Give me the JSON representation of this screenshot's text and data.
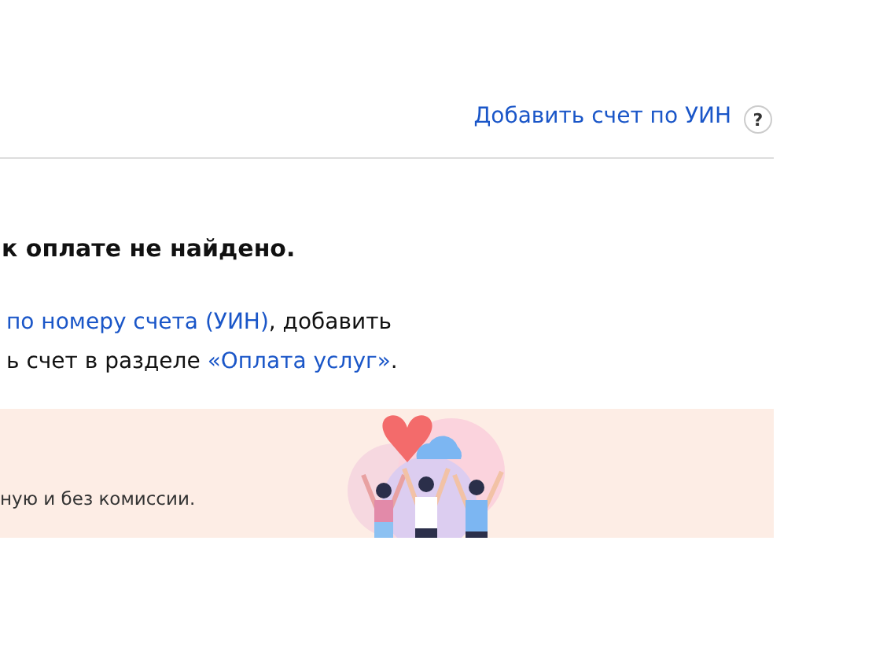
{
  "header": {
    "add_link": "Добавить счет по УИН",
    "help": "?"
  },
  "heading": "к оплате не найдено.",
  "paragraph": {
    "lines": [
      [
        {
          "kind": "link",
          "text": "по номеру счета (УИН)"
        },
        {
          "kind": "text",
          "text": ", добавить"
        }
      ],
      [
        {
          "kind": "text",
          "text": "ь счет в разделе "
        },
        {
          "kind": "link",
          "text": "«Оплата услуг»"
        },
        {
          "kind": "text",
          "text": "."
        }
      ]
    ]
  },
  "banner": {
    "text": "ную и без комиссии."
  }
}
